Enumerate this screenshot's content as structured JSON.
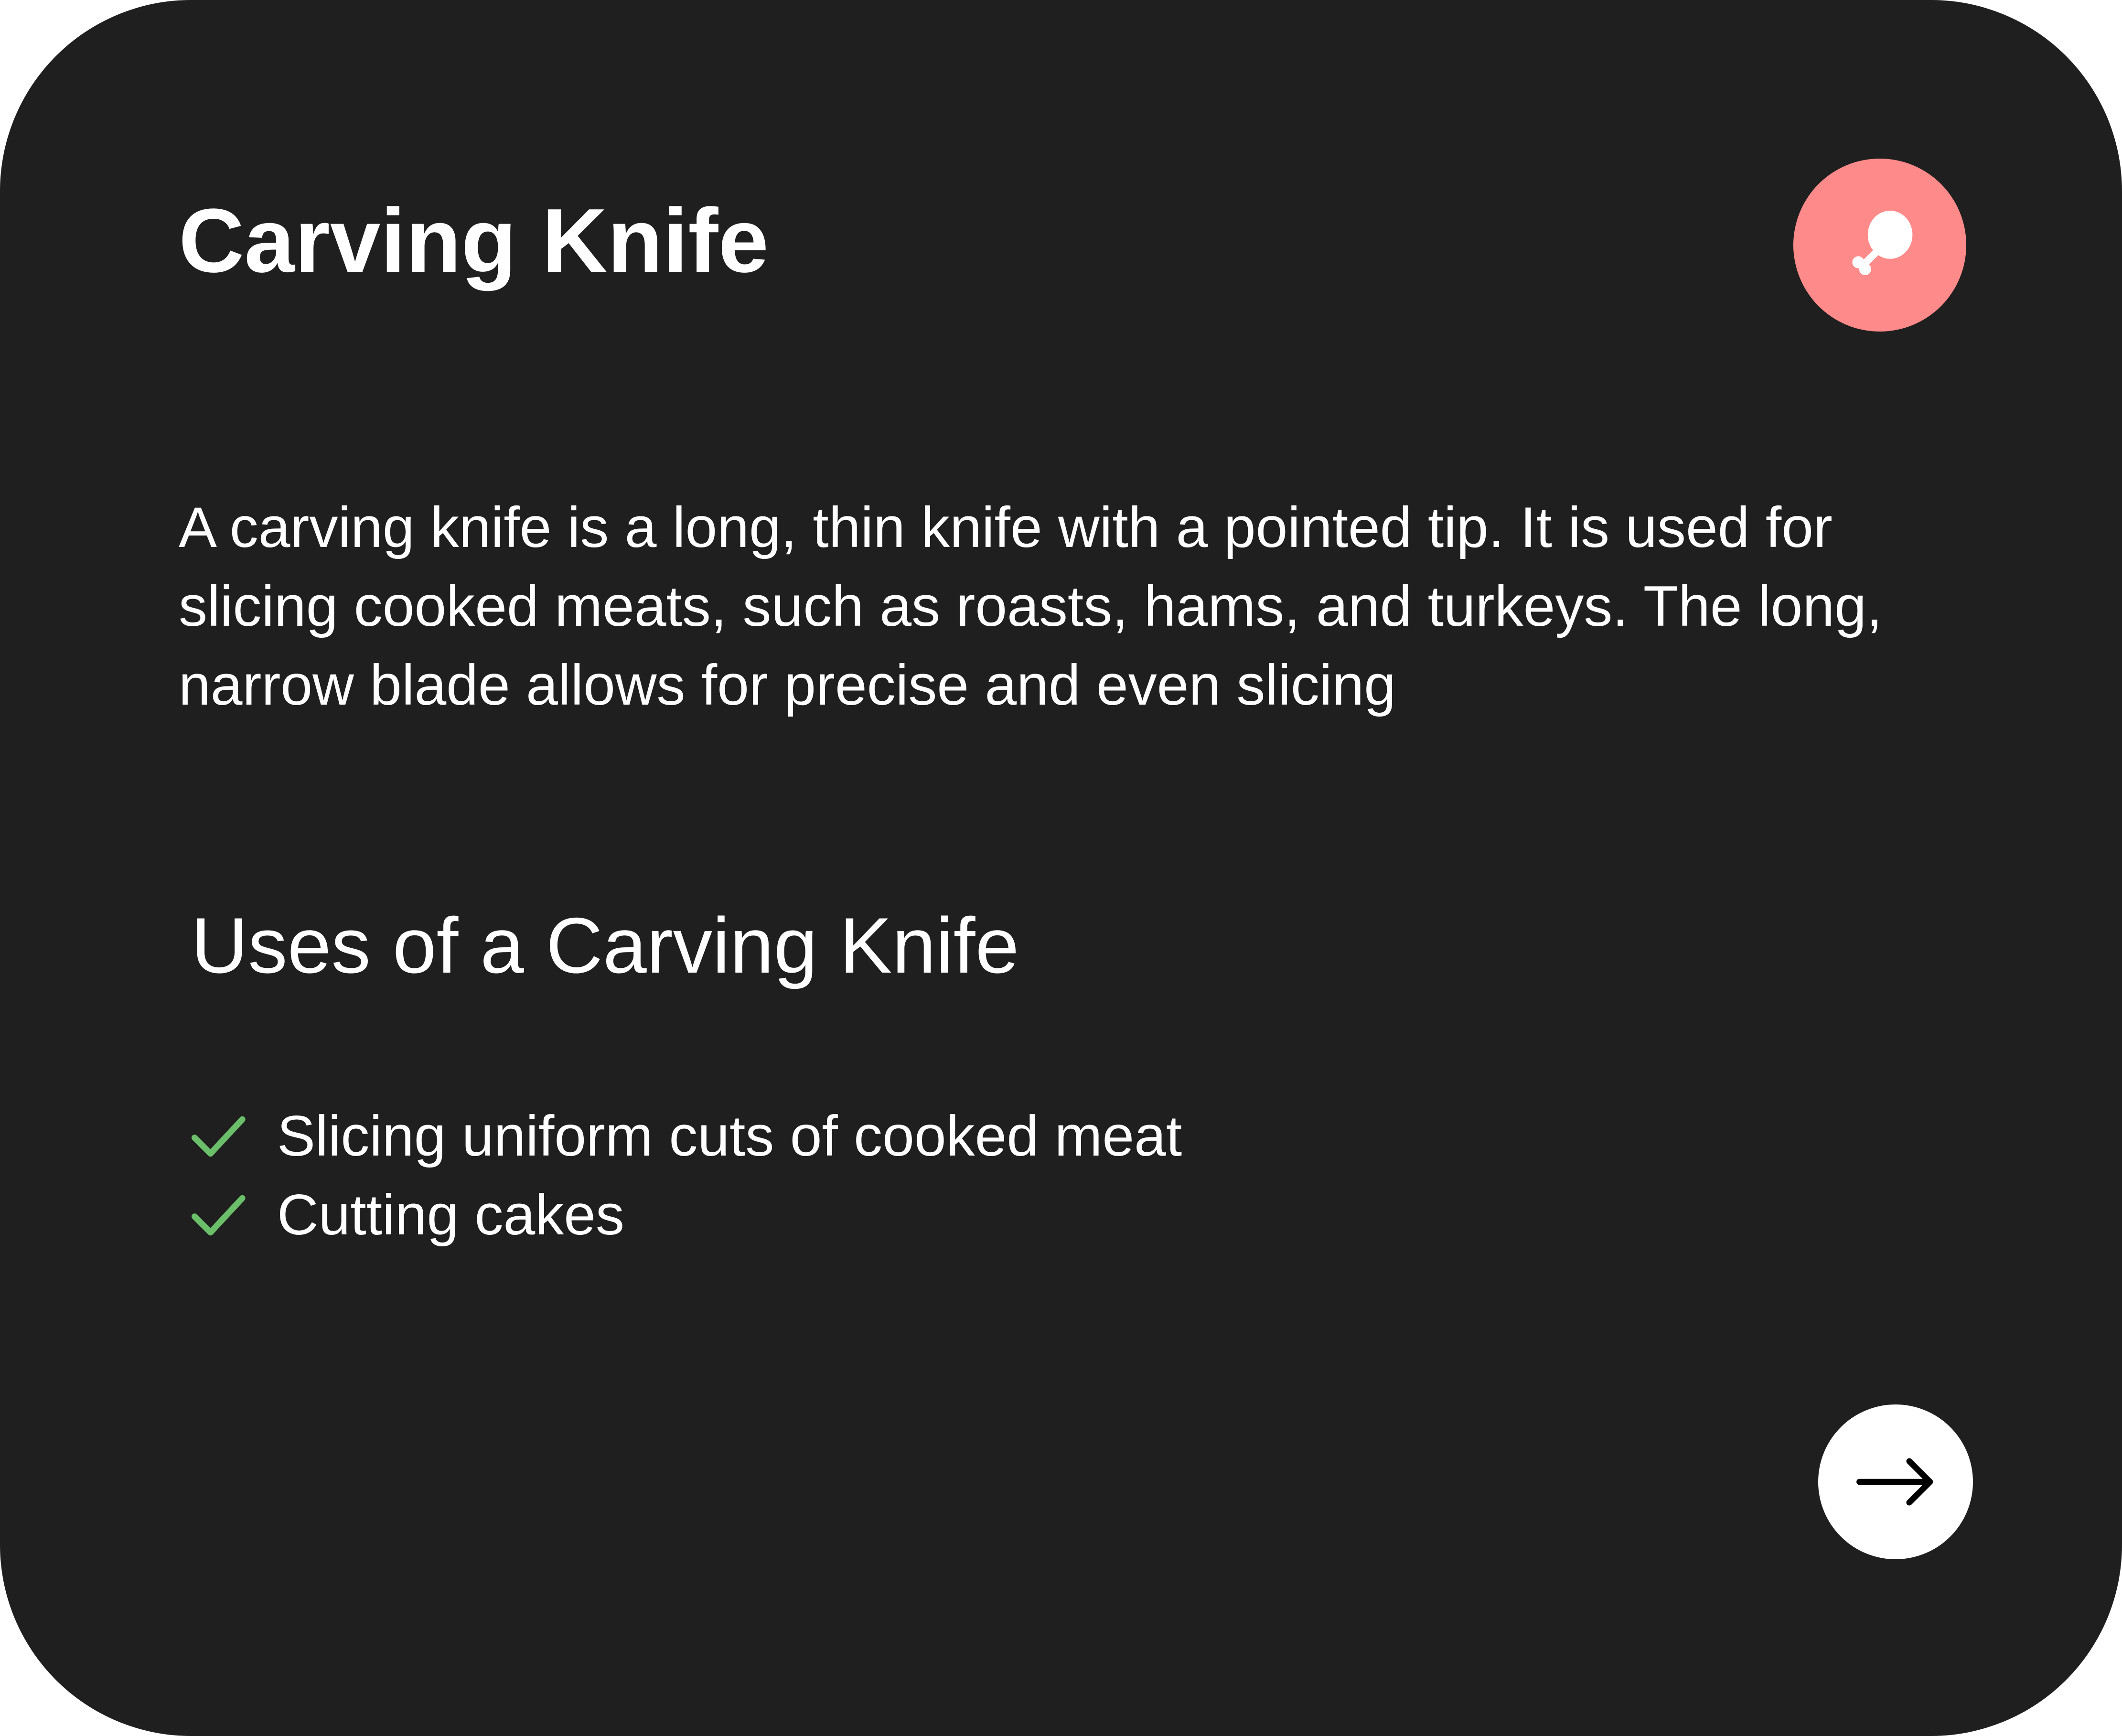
{
  "card": {
    "title": "Carving Knife",
    "badge_icon": "drumstick-icon",
    "badge_color": "#ff8a8a",
    "description": "A carving knife is a long, thin knife with a pointed tip. It is used for slicing cooked meats, such as roasts, hams, and turkeys. The long, narrow blade allows for precise and even slicing",
    "uses": {
      "heading": "Uses of a Carving Knife",
      "items": [
        {
          "icon": "check-icon",
          "text": "Slicing uniform cuts of cooked meat"
        },
        {
          "icon": "check-icon",
          "text": "Cutting cakes"
        }
      ],
      "check_color": "#6cbf6a"
    },
    "next_button_icon": "arrow-right-icon",
    "background_color": "#1f1f1f"
  }
}
